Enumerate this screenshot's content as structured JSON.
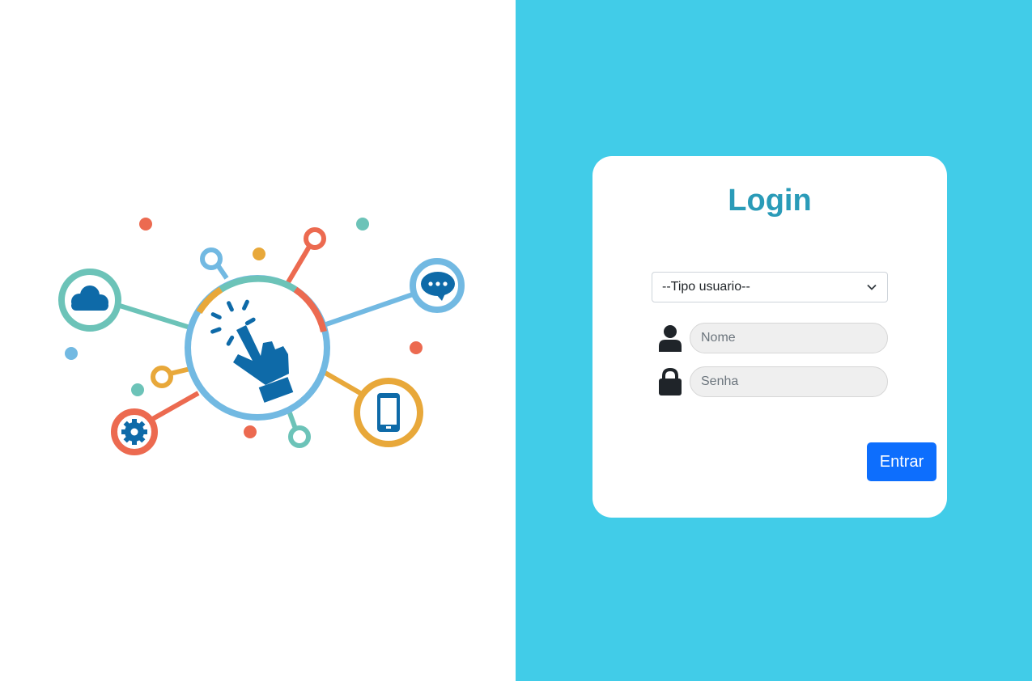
{
  "illustration": {
    "icons": [
      "cloud-icon",
      "chat-bubble-icon",
      "pointing-hand-icon",
      "gear-icon",
      "smartphone-icon"
    ],
    "colors": {
      "teal": "#6cc3b8",
      "blue": "#72b9e2",
      "red": "#ec6a50",
      "yellow": "#e8a83a",
      "dark_blue": "#0e6aa8"
    }
  },
  "login": {
    "title": "Login",
    "user_type_select": {
      "selected": "--Tipo usuario--"
    },
    "name_field": {
      "placeholder": "Nome",
      "value": ""
    },
    "password_field": {
      "placeholder": "Senha",
      "value": ""
    },
    "submit_label": "Entrar"
  },
  "colors": {
    "right_background": "#41cce8",
    "title": "#2a9bb8",
    "button": "#0d6efd"
  }
}
